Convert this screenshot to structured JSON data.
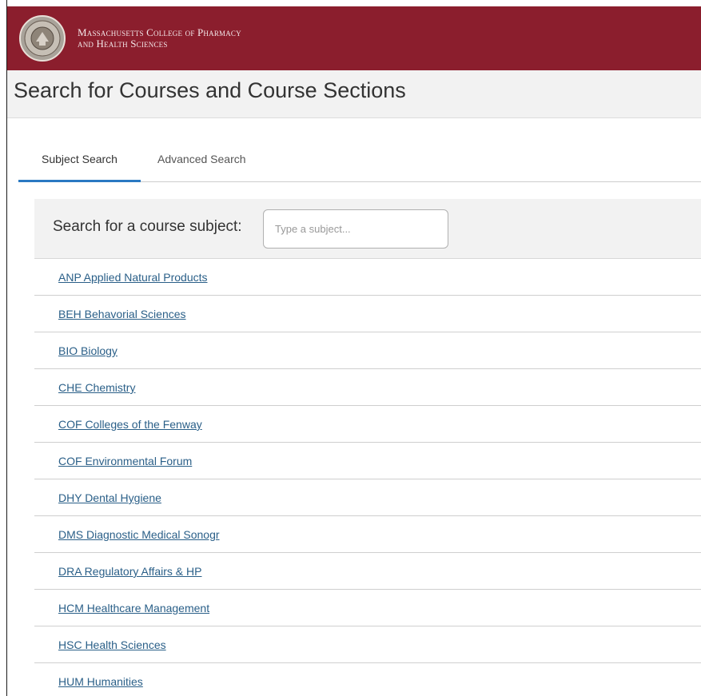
{
  "header": {
    "college_name_line1": "Massachusetts College of Pharmacy",
    "college_name_line2": "and Health Sciences",
    "brand_color": "#8b1e2d"
  },
  "page": {
    "title": "Search for Courses and Course Sections"
  },
  "tabs": [
    {
      "label": "Subject Search",
      "active": true
    },
    {
      "label": "Advanced Search",
      "active": false
    }
  ],
  "search": {
    "label": "Search for a course subject:",
    "placeholder": "Type a subject...",
    "value": ""
  },
  "subjects": [
    "ANP Applied Natural Products",
    "BEH Behavorial Sciences",
    "BIO Biology",
    "CHE Chemistry",
    "COF Colleges of the Fenway",
    "COF Environmental Forum",
    "DHY Dental Hygiene",
    "DMS Diagnostic Medical Sonogr",
    "DRA Regulatory Affairs & HP",
    "HCM Healthcare Management",
    "HSC Health Sciences",
    "HUM Humanities"
  ]
}
